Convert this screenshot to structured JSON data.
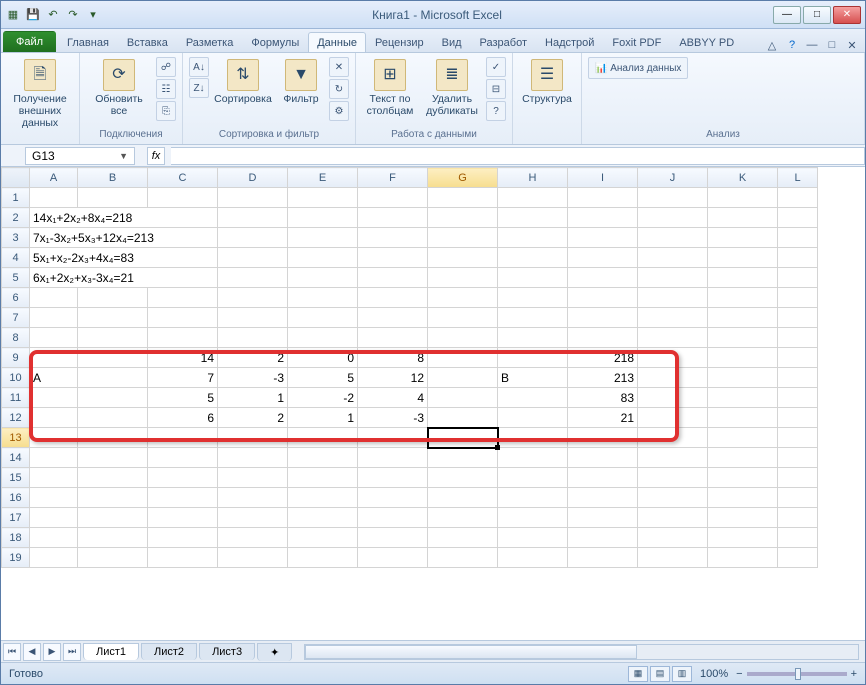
{
  "title": "Книга1 - Microsoft Excel",
  "qat": {
    "save": "💾",
    "undo": "↶",
    "redo": "↷"
  },
  "tabs": {
    "file": "Файл",
    "items": [
      "Главная",
      "Вставка",
      "Разметка",
      "Формулы",
      "Данные",
      "Рецензир",
      "Вид",
      "Разработ",
      "Надстрой",
      "Foxit PDF",
      "ABBYY PD"
    ],
    "active_index": 4
  },
  "ribbon": {
    "g1": {
      "btn": "Получение внешних данных",
      "label": ""
    },
    "g2": {
      "btn": "Обновить все",
      "label": "Подключения"
    },
    "g3": {
      "sort": "Сортировка",
      "filter": "Фильтр",
      "label": "Сортировка и фильтр"
    },
    "g4": {
      "t2c": "Текст по столбцам",
      "dup": "Удалить дубликаты",
      "label": "Работа с данными"
    },
    "g5": {
      "btn": "Структура",
      "label": ""
    },
    "g6": {
      "btn": "Анализ данных",
      "label": "Анализ"
    }
  },
  "namebox": "G13",
  "formula": "",
  "columns": [
    "A",
    "B",
    "C",
    "D",
    "E",
    "F",
    "G",
    "H",
    "I",
    "J",
    "K",
    "L"
  ],
  "eq_rows": [
    "14x₁+2x₂+8x₄=218",
    "7x₁-3x₂+5x₃+12x₄=213",
    "5x₁+x₂-2x₃+4x₄=83",
    "6x₁+2x₂+x₃-3x₄=21"
  ],
  "matrix": {
    "labelA": "A",
    "labelB": "B",
    "rows": [
      {
        "c": "14",
        "d": "2",
        "e": "0",
        "f": "8",
        "i": "218"
      },
      {
        "c": "7",
        "d": "-3",
        "e": "5",
        "f": "12",
        "i": "213"
      },
      {
        "c": "5",
        "d": "1",
        "e": "-2",
        "f": "4",
        "i": "83"
      },
      {
        "c": "6",
        "d": "2",
        "e": "1",
        "f": "-3",
        "i": "21"
      }
    ]
  },
  "sheets": [
    "Лист1",
    "Лист2",
    "Лист3"
  ],
  "status": {
    "ready": "Готово",
    "zoom": "100%"
  }
}
